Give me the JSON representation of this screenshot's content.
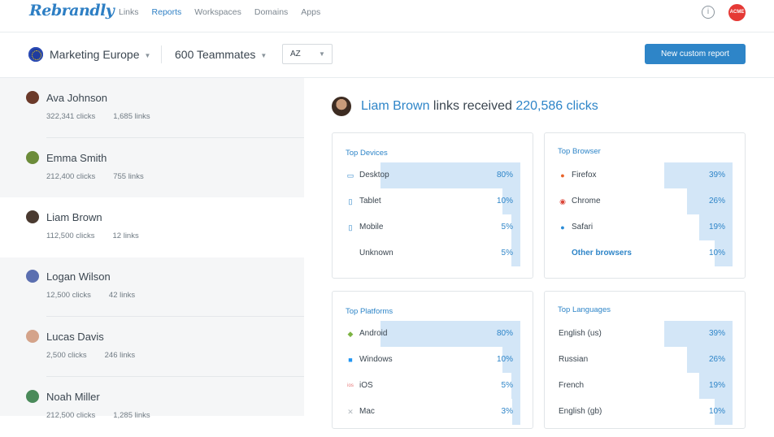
{
  "app": {
    "logo": "Rebrandly"
  },
  "nav": [
    {
      "label": "Links",
      "active": false
    },
    {
      "label": "Reports",
      "active": true
    },
    {
      "label": "Workspaces",
      "active": false
    },
    {
      "label": "Domains",
      "active": false
    },
    {
      "label": "Apps",
      "active": false
    }
  ],
  "header_right": {
    "info_icon": "info-icon",
    "avatar_text": "ACME"
  },
  "subbar": {
    "workspace": "Marketing Europe",
    "teammates": "600 Teammates",
    "sort_value": "AZ",
    "new_button": "New custom report"
  },
  "people": [
    {
      "name": "Ava Johnson",
      "clicks": "322,341 clicks",
      "links": "1,685 links",
      "avatar_color": "#6b3a2a"
    },
    {
      "name": "Emma Smith",
      "clicks": "212,400 clicks",
      "links": "755 links",
      "avatar_color": "#6c8c3a"
    },
    {
      "name": "Liam Brown",
      "clicks": "112,500 clicks",
      "links": "12 links",
      "avatar_color": "#4a3a30",
      "selected": true
    },
    {
      "name": "Logan Wilson",
      "clicks": "12,500 clicks",
      "links": "42 links",
      "avatar_color": "#5b6fb0"
    },
    {
      "name": "Lucas Davis",
      "clicks": "2,500 clicks",
      "links": "246 links",
      "avatar_color": "#d4a38a"
    },
    {
      "name": "Noah Miller",
      "clicks": "212,500 clicks",
      "links": "1,285 links",
      "avatar_color": "#4a8a5a"
    }
  ],
  "report": {
    "name": "Liam Brown",
    "mid": " links received ",
    "clicks": "220,586 clicks"
  },
  "cards": {
    "devices": {
      "title": "Top Devices",
      "rows": [
        {
          "label": "Desktop",
          "pct": "80%",
          "value": 80,
          "icon": "desktop-icon"
        },
        {
          "label": "Tablet",
          "pct": "10%",
          "value": 10,
          "icon": "tablet-icon"
        },
        {
          "label": "Mobile",
          "pct": "5%",
          "value": 5,
          "icon": "mobile-icon"
        },
        {
          "label": "Unknown",
          "pct": "5%",
          "value": 5,
          "icon": ""
        }
      ]
    },
    "browser": {
      "title": "Top Browser",
      "rows": [
        {
          "label": "Firefox",
          "pct": "39%",
          "value": 39,
          "icon": "firefox-icon"
        },
        {
          "label": "Chrome",
          "pct": "26%",
          "value": 26,
          "icon": "chrome-icon"
        },
        {
          "label": "Safari",
          "pct": "19%",
          "value": 19,
          "icon": "safari-icon"
        },
        {
          "label": "Other browsers",
          "pct": "10%",
          "value": 10,
          "icon": ""
        }
      ]
    },
    "platforms": {
      "title": "Top Platforms",
      "rows": [
        {
          "label": "Android",
          "pct": "80%",
          "value": 80,
          "icon": "android-icon"
        },
        {
          "label": "Windows",
          "pct": "10%",
          "value": 10,
          "icon": "windows-icon"
        },
        {
          "label": "iOS",
          "pct": "5%",
          "value": 5,
          "icon": "ios-icon"
        },
        {
          "label": "Mac",
          "pct": "3%",
          "value": 3,
          "icon": "mac-icon"
        }
      ]
    },
    "languages": {
      "title": "Top Languages",
      "rows": [
        {
          "label": "English (us)",
          "pct": "39%",
          "value": 39
        },
        {
          "label": "Russian",
          "pct": "26%",
          "value": 26
        },
        {
          "label": "French",
          "pct": "19%",
          "value": 19
        },
        {
          "label": "English (gb)",
          "pct": "10%",
          "value": 10
        }
      ]
    }
  },
  "colors": {
    "accent": "#2e85c8",
    "bar": "#d3e6f7",
    "sidebar": "#f5f6f7"
  }
}
